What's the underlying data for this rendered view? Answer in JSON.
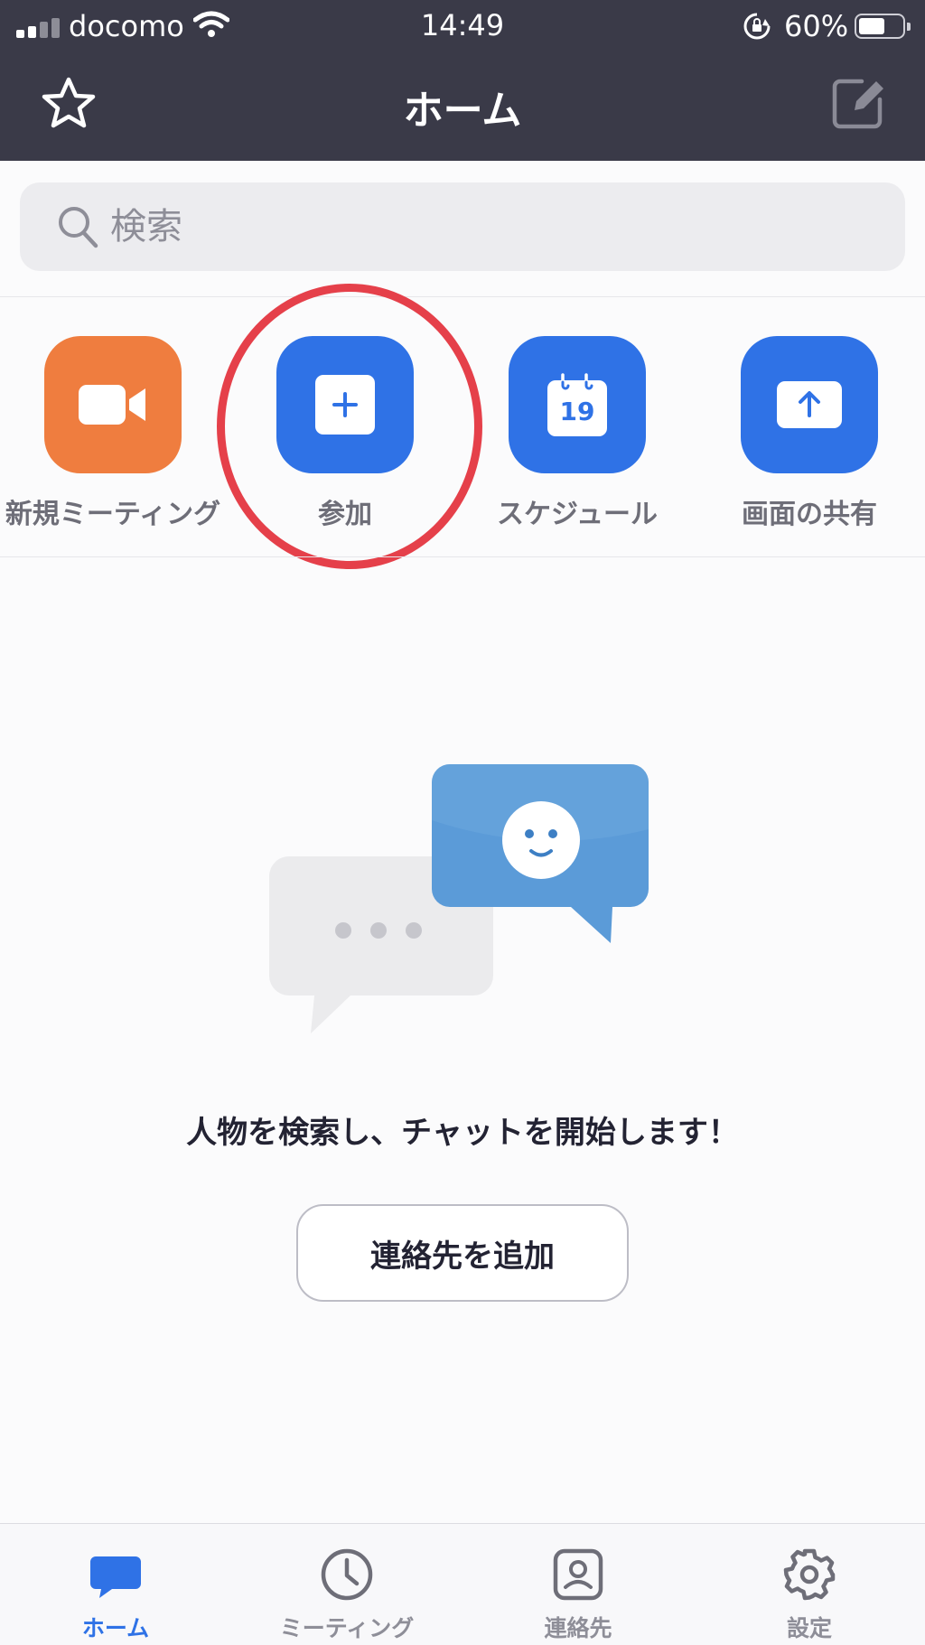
{
  "status_bar": {
    "carrier": "docomo",
    "time": "14:49",
    "battery_percent": "60%",
    "battery_level": 0.6,
    "icons": [
      "signal-icon",
      "wifi-icon",
      "rotation-lock-icon",
      "battery-icon"
    ]
  },
  "header": {
    "title": "ホーム",
    "left_icon": "star-icon",
    "right_icon": "edit-icon"
  },
  "search": {
    "placeholder": "検索",
    "value": ""
  },
  "quick_actions": [
    {
      "label": "新規ミーティング",
      "icon": "video-camera-icon",
      "color": "#ef7d3f"
    },
    {
      "label": "参加",
      "icon": "plus-icon",
      "color": "#2f72e6"
    },
    {
      "label": "スケジュール",
      "icon": "calendar-icon",
      "color": "#2f72e6",
      "calendar_day": "19"
    },
    {
      "label": "画面の共有",
      "icon": "share-screen-icon",
      "color": "#2f72e6"
    }
  ],
  "empty_state": {
    "message": "人物を検索し、チャットを開始します！",
    "button_label": "連絡先を追加"
  },
  "tab_bar": {
    "active": "ホーム",
    "items": [
      {
        "label": "ホーム",
        "icon": "chat-bubble-icon"
      },
      {
        "label": "ミーティング",
        "icon": "clock-icon"
      },
      {
        "label": "連絡先",
        "icon": "contacts-icon"
      },
      {
        "label": "設定",
        "icon": "gear-icon"
      }
    ]
  },
  "colors": {
    "header_bg": "#3a3a48",
    "accent": "#2f72e6",
    "new_meeting": "#ef7d3f",
    "highlight": "#e5404a"
  }
}
